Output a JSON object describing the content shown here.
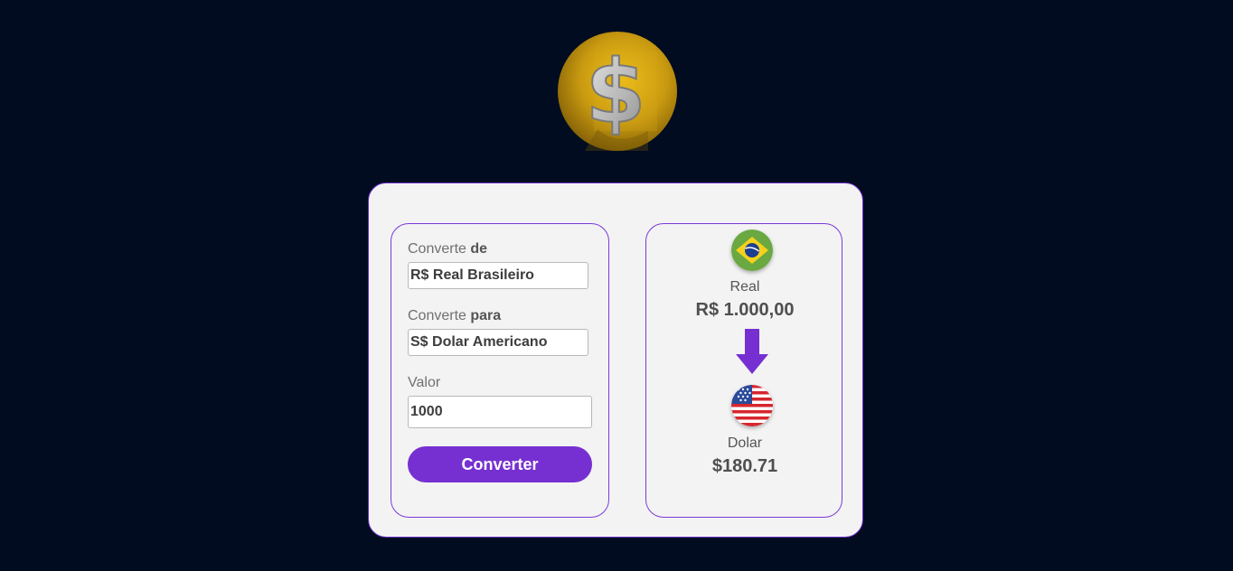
{
  "form": {
    "from_label_prefix": "Converte ",
    "from_label_bold": "de",
    "from_selected": "R$ Real Brasileiro",
    "to_label_prefix": "Converte ",
    "to_label_bold": "para",
    "to_selected": "S$ Dolar Americano",
    "value_label": "Valor",
    "value_input": "1000",
    "convert_button": "Converter"
  },
  "result": {
    "from_currency_name": "Real",
    "from_currency_value": "R$ 1.000,00",
    "to_currency_name": "Dolar",
    "to_currency_value": "$180.71"
  },
  "icons": {
    "logo": "gold-dollar-coin-icon",
    "from_flag": "brazil-flag-icon",
    "to_flag": "usa-flag-icon",
    "arrow": "arrow-down-icon"
  },
  "colors": {
    "background": "#020c20",
    "accent": "#7630d1",
    "card": "#f3f3f3"
  }
}
